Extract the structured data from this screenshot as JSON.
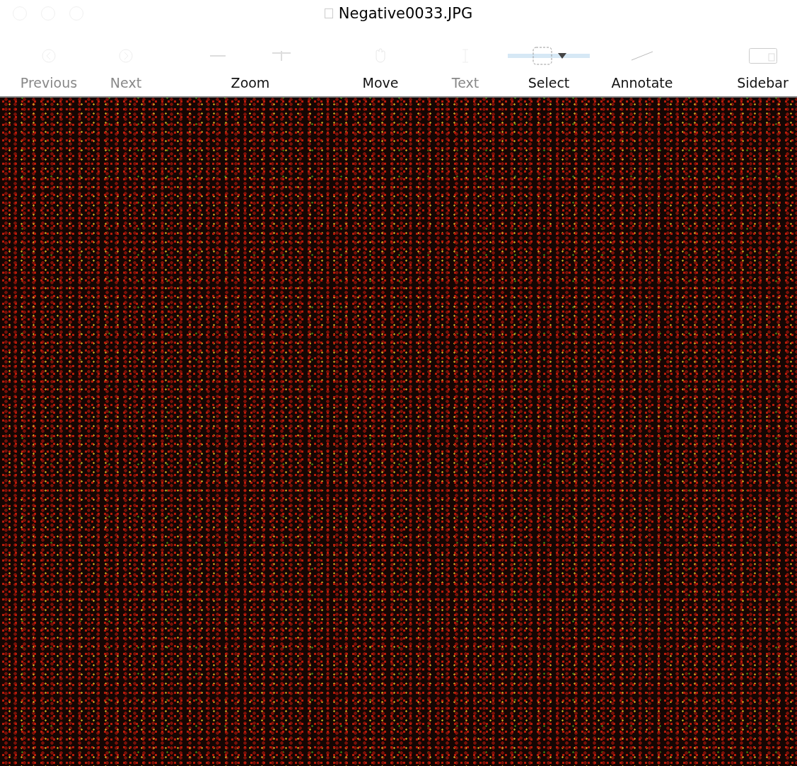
{
  "window": {
    "title": "Negative0033.JPG"
  },
  "toolbar": [
    {
      "kind": "previous",
      "label": "Previous",
      "disabled": true,
      "selected": false
    },
    {
      "kind": "next",
      "label": "Next",
      "disabled": true,
      "selected": false
    },
    {
      "kind": "zoom",
      "label": "Zoom",
      "disabled": false,
      "selected": false
    },
    {
      "kind": "move",
      "label": "Move",
      "disabled": false,
      "selected": false
    },
    {
      "kind": "text",
      "label": "Text",
      "disabled": true,
      "selected": false
    },
    {
      "kind": "select",
      "label": "Select",
      "disabled": false,
      "selected": true
    },
    {
      "kind": "annotate",
      "label": "Annotate",
      "disabled": false,
      "selected": false
    },
    {
      "kind": "sidebar",
      "label": "Sidebar",
      "disabled": false,
      "selected": false
    }
  ]
}
